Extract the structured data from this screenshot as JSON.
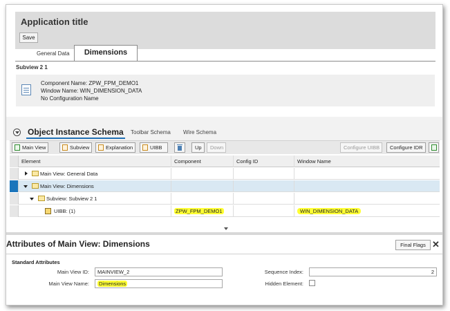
{
  "app": {
    "title": "Application title",
    "save_label": "Save"
  },
  "tabs": [
    {
      "label": "General Data",
      "active": false
    },
    {
      "label": "Dimensions",
      "active": true
    }
  ],
  "subview": {
    "title": "Subview 2 1",
    "info": [
      "Component Name: ZPW_FPM_DEMO1",
      "Window Name: WIN_DIMENSION_DATA",
      "No Configuration Name"
    ]
  },
  "schema": {
    "title": "Object Instance Schema",
    "tabs": [
      "Toolbar Schema",
      "Wire Schema"
    ],
    "toolbar": {
      "main_view": "Main View",
      "subview": "Subview",
      "explanation": "Explanation",
      "uibb": "UIBB",
      "up": "Up",
      "down": "Down",
      "configure_uibb": "Configure UIBB",
      "configure_idr": "Configure IDR"
    },
    "columns": [
      "Element",
      "Component",
      "Config ID",
      "Window Name"
    ],
    "rows": [
      {
        "element": "Main View: General Data",
        "component": "",
        "config_id": "",
        "window": ""
      },
      {
        "element": "Main View: Dimensions",
        "component": "",
        "config_id": "",
        "window": ""
      },
      {
        "element": "Subview: Subview 2  1",
        "component": "",
        "config_id": "",
        "window": ""
      },
      {
        "element": "UIBB: (1)",
        "component": "ZPW_FPM_DEMO1",
        "config_id": "",
        "window": "WIN_DIMENSION_DATA"
      }
    ]
  },
  "attributes": {
    "title": "Attributes of Main View: Dimensions",
    "final_flags": "Final Flags",
    "section": "Standard Attributes",
    "main_view_id_label": "Main View ID:",
    "main_view_id": "MAINVIEW_2",
    "main_view_name_label": "Main View Name:",
    "main_view_name": "Dimensions",
    "sequence_index_label": "Sequence Index:",
    "sequence_index": "2",
    "hidden_element_label": "Hidden Element:"
  },
  "colors": {
    "accent": "#1b75bb",
    "highlight": "#ffff33",
    "selected_row": "#d9e8f3"
  }
}
